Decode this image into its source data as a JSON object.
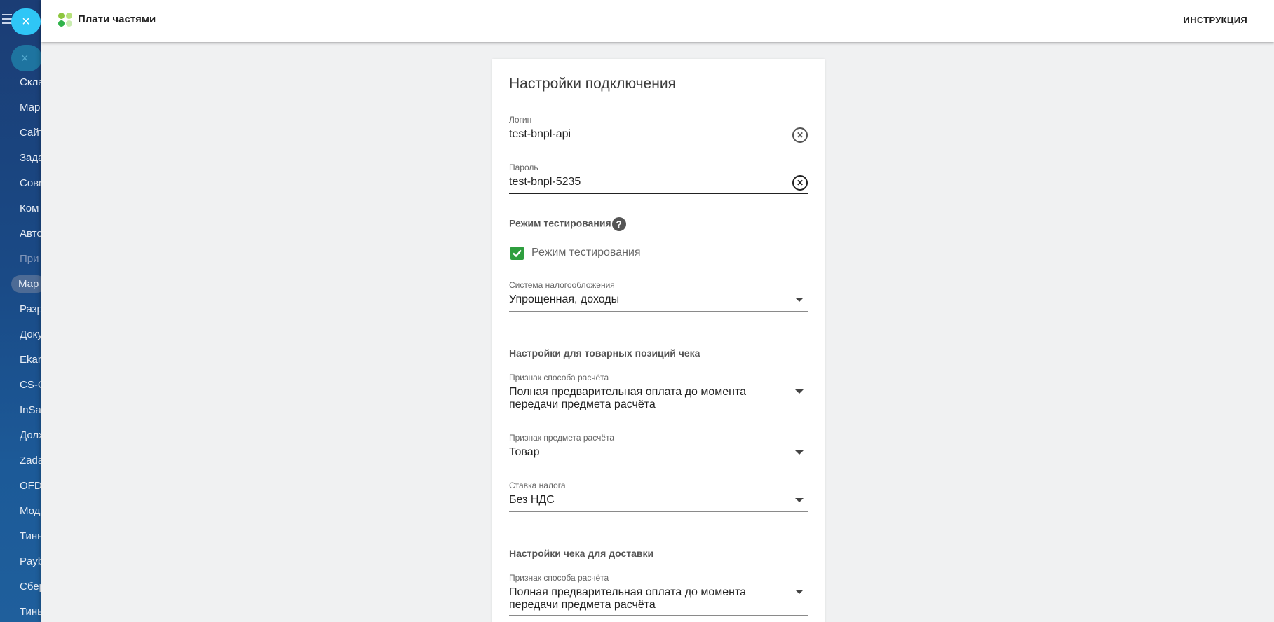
{
  "background_sidebar": {
    "items": [
      {
        "label": "Скла",
        "style": "normal"
      },
      {
        "label": "Мар",
        "style": "normal"
      },
      {
        "label": "Сайт",
        "style": "normal"
      },
      {
        "label": "Зада",
        "style": "normal"
      },
      {
        "label": "Совм",
        "style": "normal"
      },
      {
        "label": "Ком",
        "style": "normal"
      },
      {
        "label": "Авто",
        "style": "normal"
      },
      {
        "label": "При",
        "style": "dim"
      },
      {
        "label": "Мар",
        "style": "active"
      },
      {
        "label": "Разр",
        "style": "normal"
      },
      {
        "label": "Доку",
        "style": "normal"
      },
      {
        "label": "Ekar",
        "style": "normal"
      },
      {
        "label": "CS-C",
        "style": "normal"
      },
      {
        "label": "InSa",
        "style": "normal"
      },
      {
        "label": "Долх",
        "style": "normal"
      },
      {
        "label": "Zada",
        "style": "normal"
      },
      {
        "label": "OFD",
        "style": "normal"
      },
      {
        "label": "Мод",
        "style": "normal"
      },
      {
        "label": "Тинь",
        "style": "normal"
      },
      {
        "label": "Payb",
        "style": "normal"
      },
      {
        "label": "Сбер",
        "style": "normal"
      },
      {
        "label": "Тинь",
        "style": "normal"
      }
    ]
  },
  "header": {
    "app_title": "Плати частями",
    "instructions_link": "ИНСТРУКЦИЯ",
    "logo_colors": [
      "#8dc63f",
      "#b5e07a",
      "#2fb34a",
      "#c8ecb0"
    ]
  },
  "form": {
    "title": "Настройки подключения",
    "login": {
      "label": "Логин",
      "value": "test-bnpl-api"
    },
    "password": {
      "label": "Пароль",
      "value": "test-bnpl-5235"
    },
    "test_mode": {
      "heading": "Режим тестирования",
      "checkbox_label": "Режим тестирования",
      "checked": true
    },
    "tax_system": {
      "label": "Система налогообложения",
      "value": "Упрощенная, доходы"
    },
    "items_section": {
      "heading": "Настройки для товарных позиций чека",
      "payment_method": {
        "label": "Признак способа расчёта",
        "value": "Полная предварительная оплата до момента передачи предмета расчёта"
      },
      "payment_object": {
        "label": "Признак предмета расчёта",
        "value": "Товар"
      },
      "tax_rate": {
        "label": "Ставка налога",
        "value": "Без НДС"
      }
    },
    "delivery_section": {
      "heading": "Настройки чека для доставки",
      "payment_method": {
        "label": "Признак способа расчёта",
        "value": "Полная предварительная оплата до момента передачи предмета расчёта"
      }
    }
  },
  "colors": {
    "accent_close": "#2fc6f6",
    "checkbox": "#2e9e3e"
  }
}
